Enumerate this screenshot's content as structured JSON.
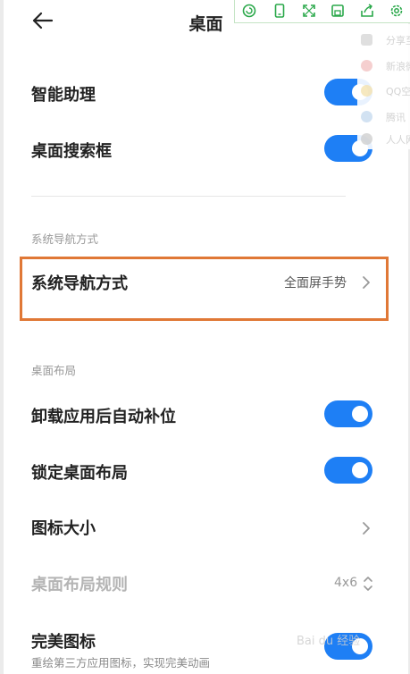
{
  "header": {
    "title": "桌面"
  },
  "rows": {
    "smart_assistant": {
      "label": "智能助理",
      "enabled": true
    },
    "desktop_search": {
      "label": "桌面搜索框",
      "enabled": true
    },
    "nav_section": "系统导航方式",
    "nav_mode": {
      "label": "系统导航方式",
      "value": "全面屏手势"
    },
    "layout_section": "桌面布局",
    "auto_fill": {
      "label": "卸载应用后自动补位",
      "enabled": true
    },
    "lock_layout": {
      "label": "锁定桌面布局",
      "enabled": true
    },
    "icon_size": {
      "label": "图标大小"
    },
    "layout_rule": {
      "label": "桌面布局规则",
      "value": "4x6"
    },
    "perfect_icon": {
      "label": "完美图标",
      "sub": "重绘第三方应用图标，实现完美动画",
      "enabled": true
    }
  },
  "share_panel": {
    "items": [
      "分享至",
      "新浪微",
      "QQ空",
      "腾讯",
      "人人网"
    ]
  },
  "watermark": "Bai du 经验",
  "colors": {
    "toggle_on": "#1e7ff5",
    "highlight_border": "#e07836",
    "toolbar_green": "#2aa84a"
  },
  "icons": {
    "back": "arrow-left-icon",
    "chevron": "chevron-right-icon",
    "updown": "chevron-updown-icon"
  }
}
